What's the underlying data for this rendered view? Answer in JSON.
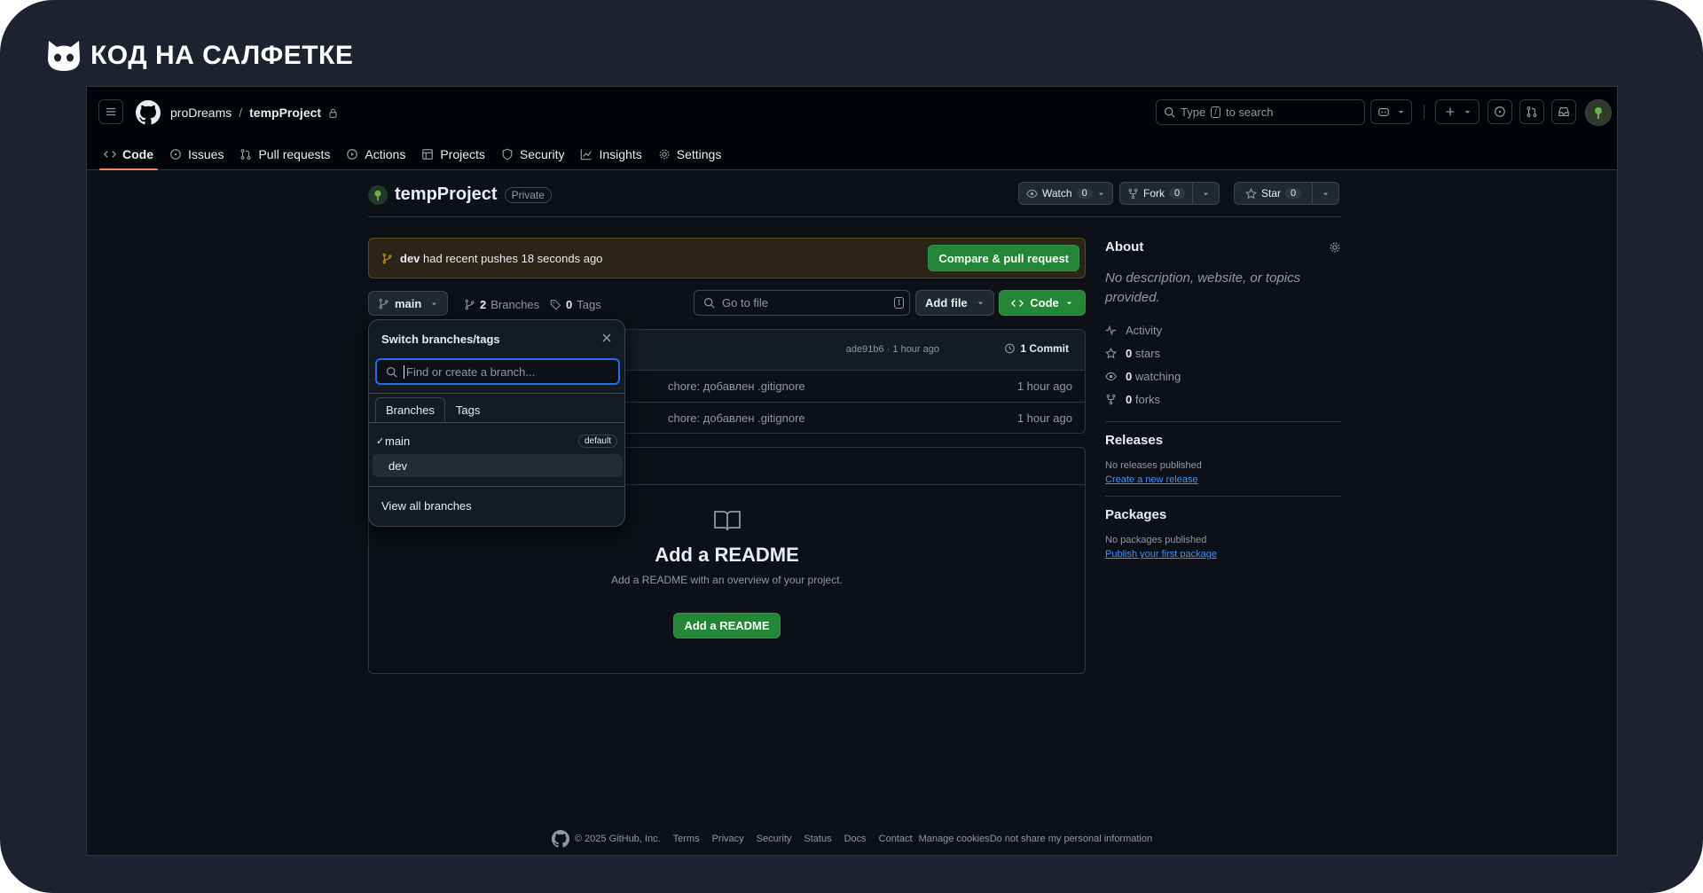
{
  "brand": {
    "name": "КОД НА САЛФЕТКЕ"
  },
  "header": {
    "owner": "proDreams",
    "separator": "/",
    "repo": "tempProject",
    "search_prefix": "Type",
    "search_key": "/",
    "search_suffix": "to search"
  },
  "tabs": [
    {
      "label": "Code",
      "icon": "code-icon"
    },
    {
      "label": "Issues",
      "icon": "issue-icon"
    },
    {
      "label": "Pull requests",
      "icon": "pull-request-icon"
    },
    {
      "label": "Actions",
      "icon": "play-icon"
    },
    {
      "label": "Projects",
      "icon": "table-icon"
    },
    {
      "label": "Security",
      "icon": "shield-icon"
    },
    {
      "label": "Insights",
      "icon": "graph-icon"
    },
    {
      "label": "Settings",
      "icon": "gear-icon"
    }
  ],
  "repo": {
    "title": "tempProject",
    "visibility": "Private",
    "watch_label": "Watch",
    "watch_count": "0",
    "fork_label": "Fork",
    "fork_count": "0",
    "star_label": "Star",
    "star_count": "0"
  },
  "banner": {
    "branch": "dev",
    "text": "had recent pushes 18 seconds ago",
    "button": "Compare & pull request"
  },
  "toolbar": {
    "branch": "main",
    "branches_count": "2",
    "branches_label": "Branches",
    "tags_count": "0",
    "tags_label": "Tags",
    "goto_placeholder": "Go to file",
    "goto_key": "t",
    "add_file": "Add file",
    "code": "Code"
  },
  "commit_bar": {
    "hash_time": "ade91b6 · 1 hour ago",
    "commits": "1 Commit"
  },
  "files": [
    {
      "message": "chore: добавлен .gitignore",
      "time": "1 hour ago"
    },
    {
      "message": "chore: добавлен .gitignore",
      "time": "1 hour ago"
    }
  ],
  "readme": {
    "title": "Add a README",
    "subtitle": "Add a README with an overview of your project.",
    "button": "Add a README"
  },
  "about": {
    "title": "About",
    "description": "No description, website, or topics provided.",
    "activity": "Activity",
    "stars_count": "0",
    "stars_label": "stars",
    "watching_count": "0",
    "watching_label": "watching",
    "forks_count": "0",
    "forks_label": "forks"
  },
  "releases": {
    "title": "Releases",
    "text": "No releases published",
    "link": "Create a new release"
  },
  "packages": {
    "title": "Packages",
    "text": "No packages published",
    "link": "Publish your first package"
  },
  "dropdown": {
    "title": "Switch branches/tags",
    "placeholder": "Find or create a branch...",
    "tab_branches": "Branches",
    "tab_tags": "Tags",
    "branches": [
      {
        "name": "main",
        "badge": "default"
      },
      {
        "name": "dev"
      }
    ],
    "view_all": "View all branches"
  },
  "footer": {
    "copyright": "© 2025 GitHub, Inc.",
    "links": [
      "Terms",
      "Privacy",
      "Security",
      "Status",
      "Docs",
      "Contact",
      "Manage cookies",
      "Do not share my personal information"
    ]
  },
  "colors": {
    "accent_green": "#238636",
    "tab_underline": "#f78166",
    "focus_blue": "#1f6feb",
    "link": "#4493f8"
  }
}
